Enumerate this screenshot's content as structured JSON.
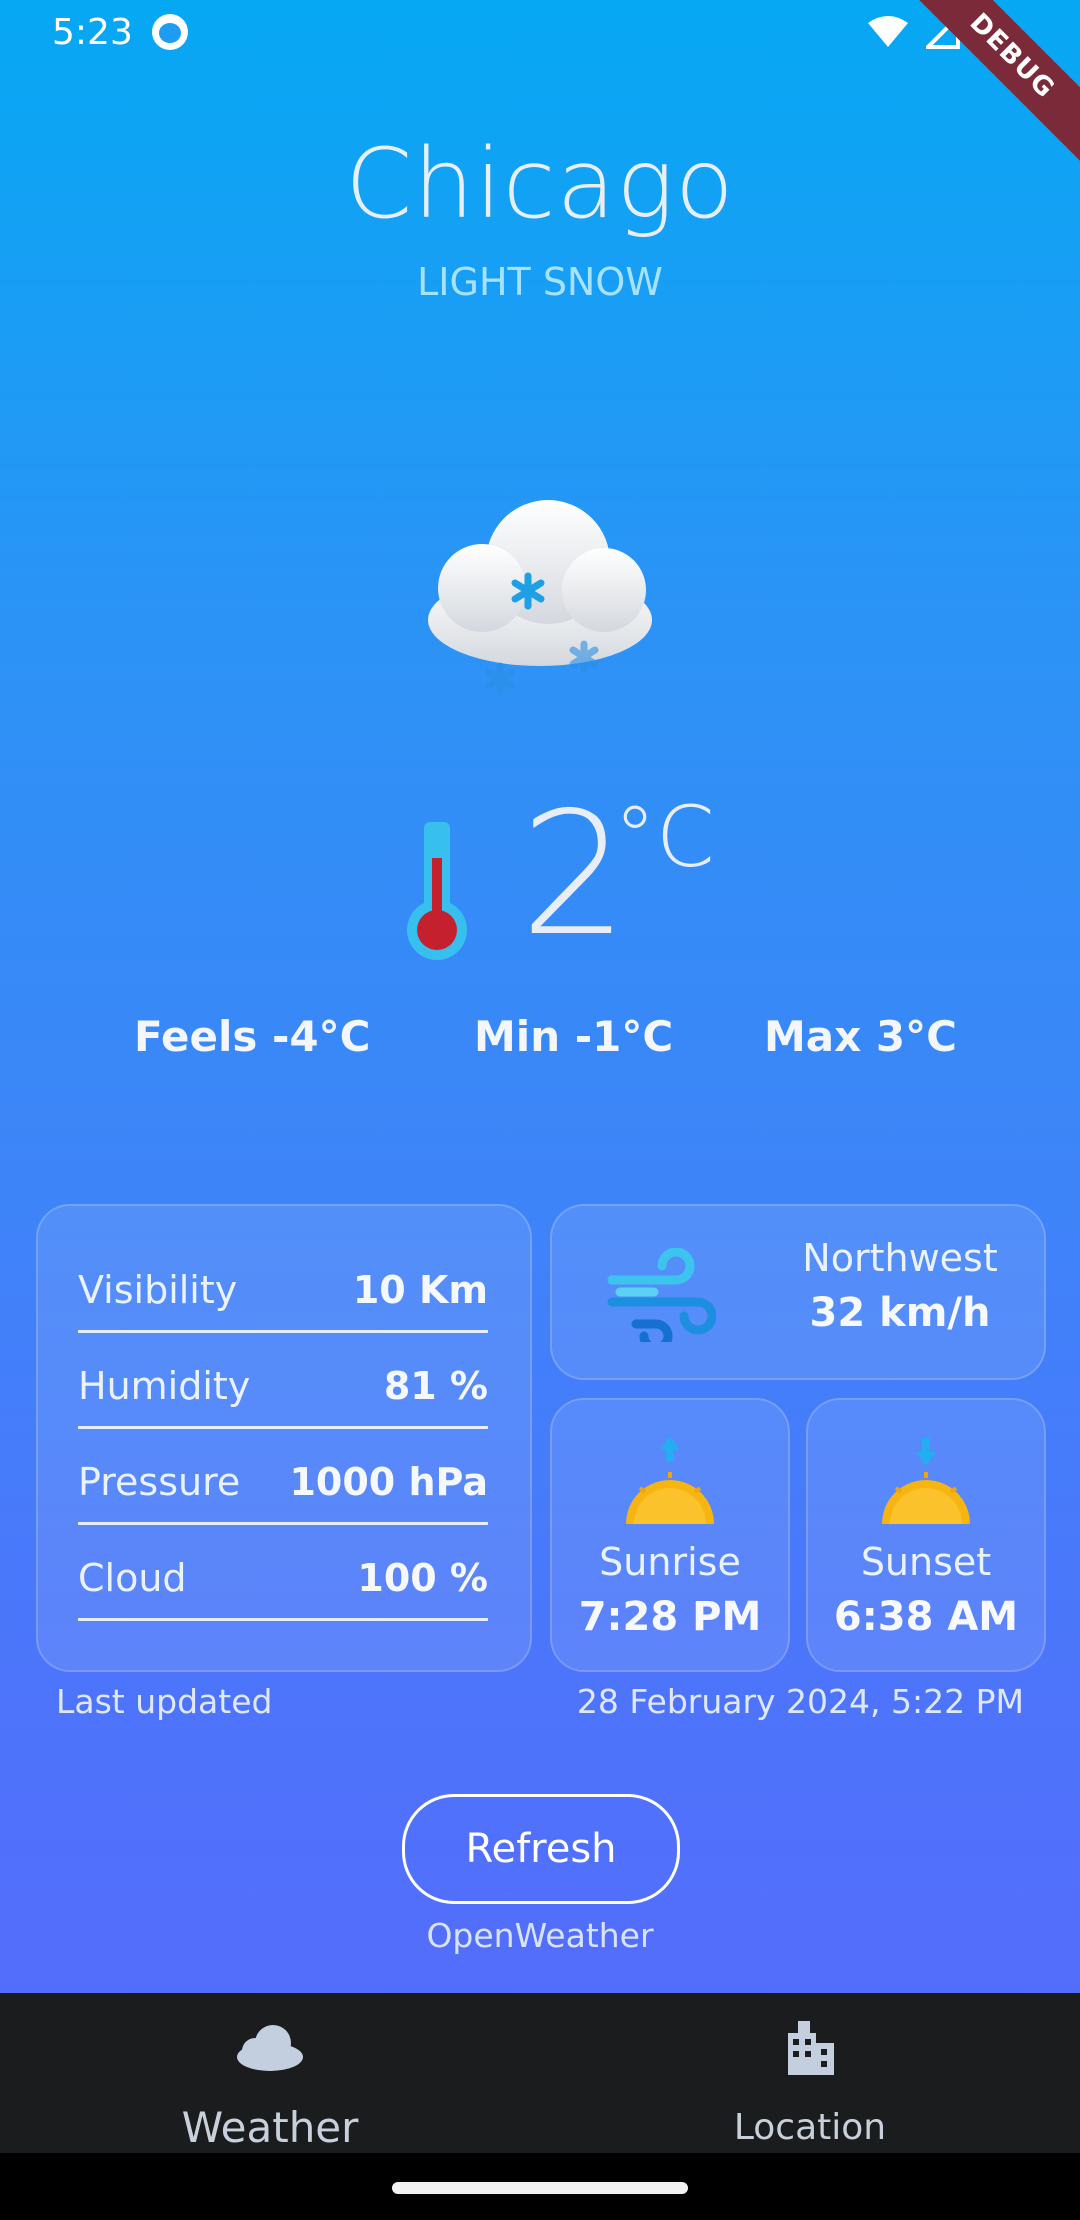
{
  "status_bar": {
    "time": "5:23",
    "debug_label": "DEBUG"
  },
  "header": {
    "city": "Chicago",
    "condition": "LIGHT SNOW"
  },
  "current": {
    "temperature": "2",
    "unit": "°C",
    "feels": "Feels -4°C",
    "min": "Min -1°C",
    "max": "Max 3°C"
  },
  "details": [
    {
      "label": "Visibility",
      "value": "10 Km"
    },
    {
      "label": "Humidity",
      "value": "81 %"
    },
    {
      "label": "Pressure",
      "value": "1000 hPa"
    },
    {
      "label": "Cloud",
      "value": "100 %"
    }
  ],
  "wind": {
    "direction": "Northwest",
    "speed": "32 km/h"
  },
  "sun": {
    "sunrise_label": "Sunrise",
    "sunrise_time": "7:28 PM",
    "sunset_label": "Sunset",
    "sunset_time": "6:38 AM"
  },
  "updated": {
    "label": "Last updated",
    "date": "28 February 2024, 5:22 PM"
  },
  "actions": {
    "refresh_label": "Refresh",
    "provider": "OpenWeather"
  },
  "nav": {
    "weather_label": "Weather",
    "location_label": "Location"
  },
  "colors": {
    "gradient_top": "#06a8f3",
    "gradient_bottom": "#5868fb",
    "nav_background": "#1b1c1e",
    "condition_text": "#a6e3fb"
  },
  "icons": [
    "snow-cloud-icon",
    "thermometer-icon",
    "wind-icon",
    "sunrise-icon",
    "sunset-icon",
    "cloud-icon",
    "building-icon",
    "wifi-icon",
    "signal-icon",
    "battery-icon"
  ]
}
